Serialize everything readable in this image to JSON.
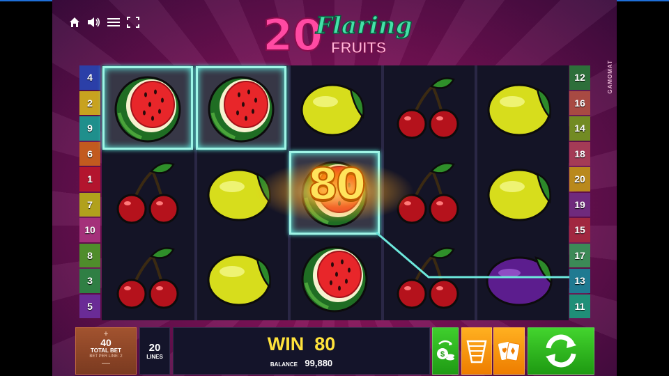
{
  "game": {
    "logo_number": "20",
    "logo_line1": "Flaring",
    "logo_line2": "FRUITS",
    "brand": "GAMOMAT"
  },
  "hud_icons": [
    "home-icon",
    "speaker-icon",
    "menu-icon",
    "fullscreen-icon"
  ],
  "lines_left": [
    {
      "n": "4",
      "color": "#2b3fa8"
    },
    {
      "n": "2",
      "color": "#c8a21f"
    },
    {
      "n": "9",
      "color": "#1f8f8c"
    },
    {
      "n": "6",
      "color": "#c25a1f"
    },
    {
      "n": "1",
      "color": "#b3152e"
    },
    {
      "n": "7",
      "color": "#b1a11c"
    },
    {
      "n": "10",
      "color": "#a4307a"
    },
    {
      "n": "8",
      "color": "#4f8d2b"
    },
    {
      "n": "3",
      "color": "#2f7f44"
    },
    {
      "n": "5",
      "color": "#6a2b96"
    }
  ],
  "lines_right": [
    {
      "n": "12",
      "color": "#2d6f3a"
    },
    {
      "n": "16",
      "color": "#a84a43"
    },
    {
      "n": "14",
      "color": "#728b23"
    },
    {
      "n": "18",
      "color": "#a43b56"
    },
    {
      "n": "20",
      "color": "#b9891c"
    },
    {
      "n": "19",
      "color": "#6f2a7d"
    },
    {
      "n": "15",
      "color": "#a12740"
    },
    {
      "n": "17",
      "color": "#3c8a57"
    },
    {
      "n": "13",
      "color": "#1f7a91"
    },
    {
      "n": "11",
      "color": "#1f8f78"
    }
  ],
  "reels": [
    [
      "watermelon",
      "cherry",
      "cherry"
    ],
    [
      "watermelon",
      "lemon",
      "lemon"
    ],
    [
      "lemon",
      "watermelon",
      "watermelon"
    ],
    [
      "cherry",
      "cherry",
      "cherry"
    ],
    [
      "lemon",
      "lemon",
      "plum"
    ]
  ],
  "highlighted_cells": [
    [
      0,
      0
    ],
    [
      1,
      0
    ],
    [
      2,
      1
    ]
  ],
  "line_win": {
    "amount": "80",
    "line": "13"
  },
  "bet": {
    "plus": "+",
    "amount": "40",
    "label": "TOTAL BET",
    "sub": "BET PER LINE: 2",
    "minus": "—"
  },
  "lines": {
    "count": "20",
    "label": "LINES"
  },
  "win": {
    "label": "WIN",
    "amount": "80"
  },
  "balance": {
    "label": "BALANCE",
    "amount": "99,880"
  },
  "controls": {
    "autoplay_icon": "autoplay-coins-icon",
    "paytable_icon": "paytable-icon",
    "gamble_icon": "gamble-cards-icon",
    "spin_icon": "spin-arrows-icon"
  }
}
